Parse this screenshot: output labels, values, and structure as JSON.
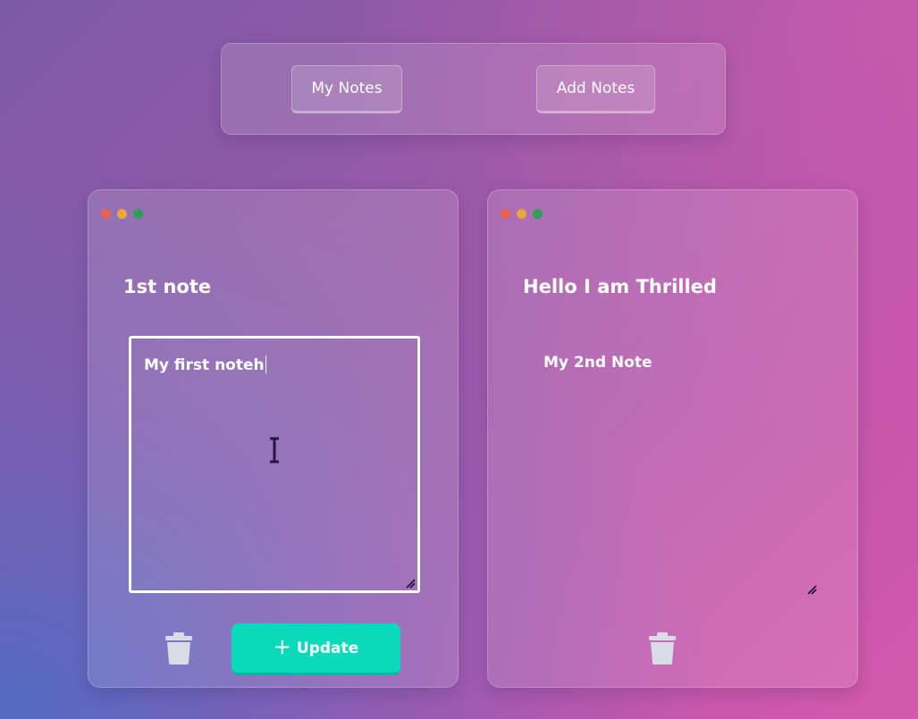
{
  "navbar": {
    "my_notes_label": "My Notes",
    "add_notes_label": "Add Notes"
  },
  "notes": [
    {
      "title": "1st note",
      "body": "My first noteh",
      "editing": true,
      "update_label": "Update",
      "update_icon": "+"
    },
    {
      "title": "Hello I am Thrilled",
      "body": "My 2nd Note",
      "editing": false
    }
  ],
  "colors": {
    "accent": "#0bd9bc",
    "dot_red": "#e8634f",
    "dot_yellow": "#eaa83a",
    "dot_green": "#2f9e57"
  },
  "icons": {
    "delete": "trash-icon",
    "resize": "resize-grip-icon",
    "cursor": "text-cursor-icon"
  }
}
